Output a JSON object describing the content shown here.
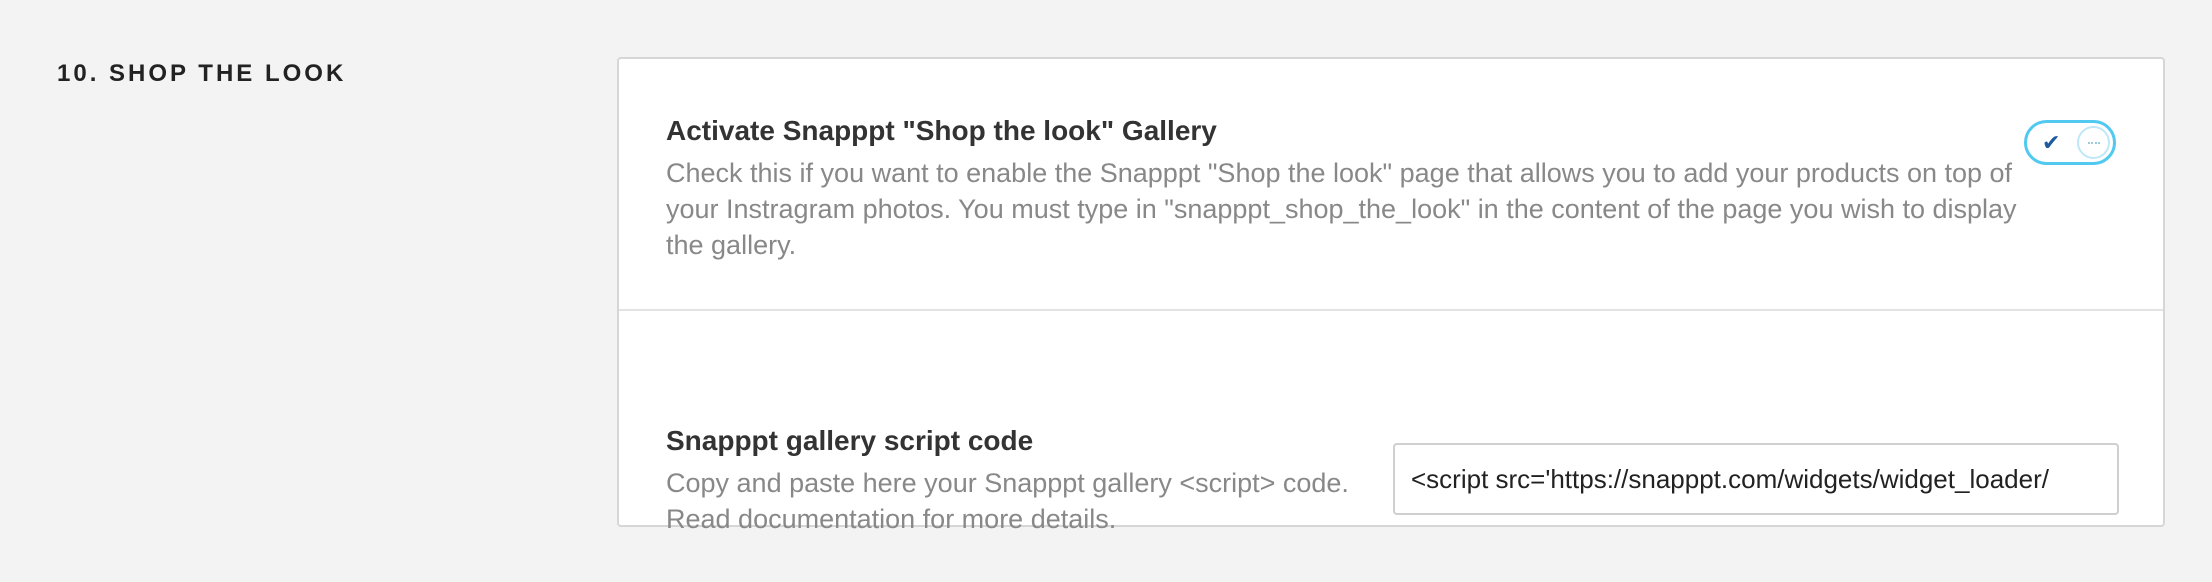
{
  "section": {
    "title": "10. SHOP THE LOOK"
  },
  "settings": {
    "gallery_toggle": {
      "title": "Activate Snapppt \"Shop the look\" Gallery",
      "description": "Check this if you want to enable the Snapppt \"Shop the look\" page that allows you to add your products on top of your Instragram photos. You must type in \"snapppt_shop_the_look\" in the content of the page you wish to display the gallery.",
      "enabled": true,
      "on_icon": "checkmark-icon"
    },
    "script_code": {
      "title": "Snapppt gallery script code",
      "description": "Copy and paste here your Snapppt gallery <script> code. Read documentation for more details.",
      "value": "<script src='https://snapppt.com/widgets/widget_loader/"
    }
  },
  "colors": {
    "page_background": "#f3f3f3",
    "card_background": "#ffffff",
    "toggle_accent": "#52c9f0",
    "check_color": "#1e5a9e",
    "description_text": "#888888"
  }
}
